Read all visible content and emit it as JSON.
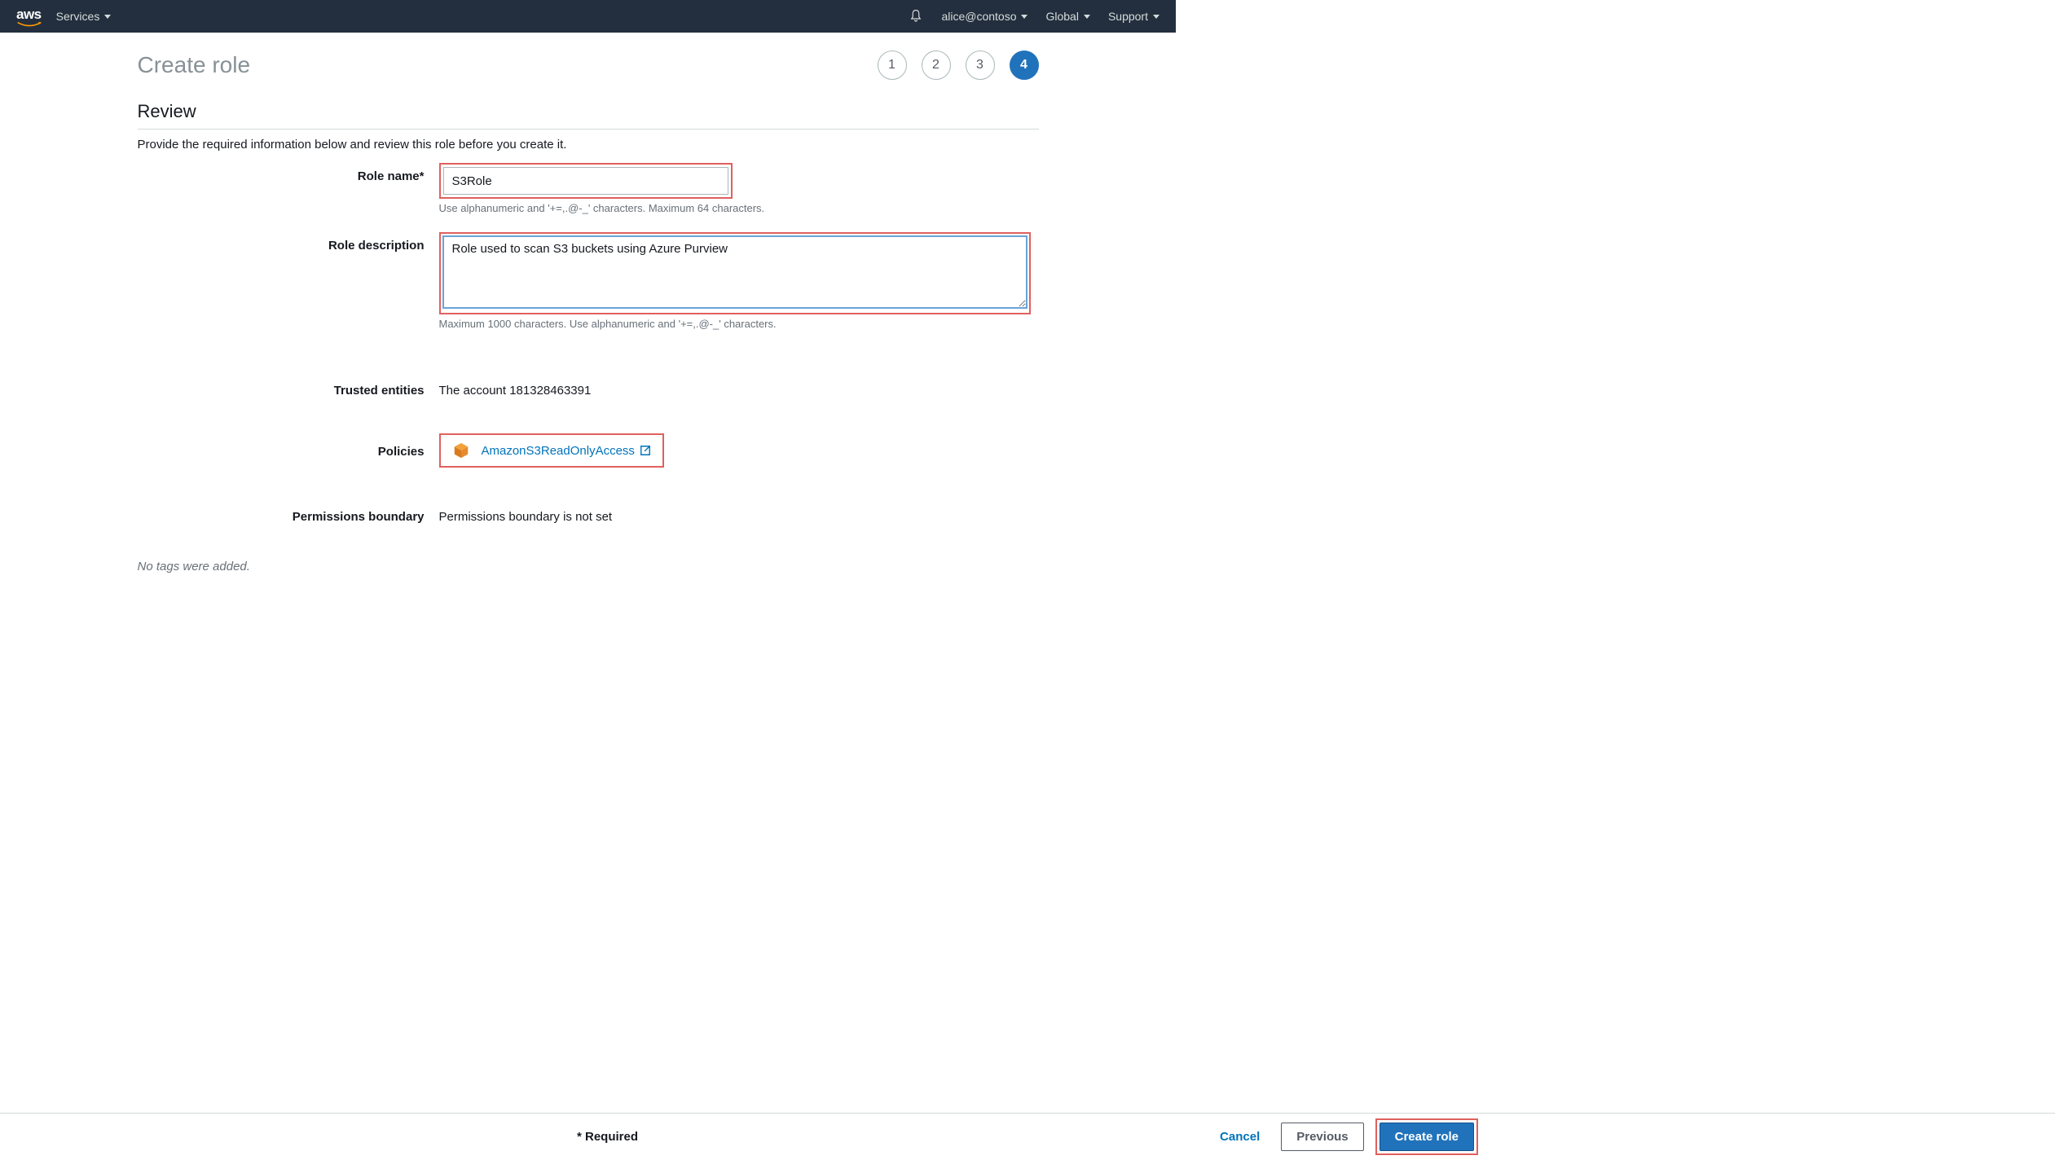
{
  "nav": {
    "logo_text": "aws",
    "services": "Services",
    "user": "alice@contoso",
    "region": "Global",
    "support": "Support"
  },
  "page": {
    "title": "Create role",
    "steps": [
      "1",
      "2",
      "3",
      "4"
    ],
    "section_title": "Review",
    "instruction": "Provide the required information below and review this role before you create it."
  },
  "form": {
    "role_name": {
      "label": "Role name*",
      "value": "S3Role",
      "hint": "Use alphanumeric and '+=,.@-_' characters. Maximum 64 characters."
    },
    "role_description": {
      "label": "Role description",
      "value": "Role used to scan S3 buckets using Azure Purview",
      "hint": "Maximum 1000 characters. Use alphanumeric and '+=,.@-_' characters."
    },
    "trusted_entities": {
      "label": "Trusted entities",
      "value": "The account 181328463391"
    },
    "policies": {
      "label": "Policies",
      "policy_name": "AmazonS3ReadOnlyAccess"
    },
    "permissions_boundary": {
      "label": "Permissions boundary",
      "value": "Permissions boundary is not set"
    },
    "no_tags": "No tags were added."
  },
  "footer": {
    "required": "* Required",
    "cancel": "Cancel",
    "previous": "Previous",
    "create": "Create role"
  }
}
